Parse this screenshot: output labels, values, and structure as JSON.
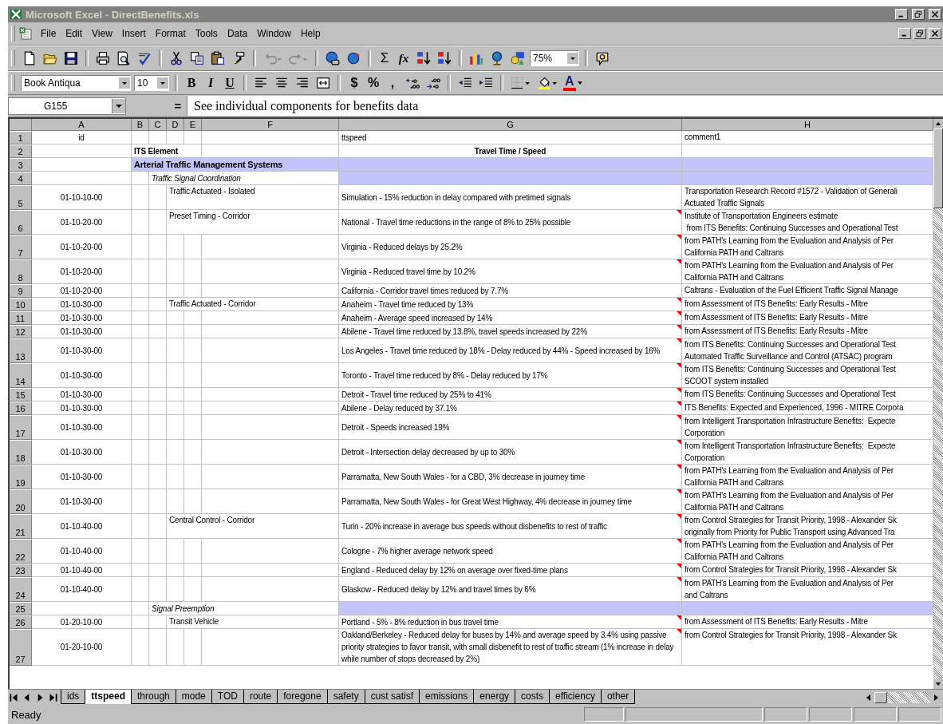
{
  "window": {
    "title": "Microsoft Excel - DirectBenefits.xls"
  },
  "menu": [
    "File",
    "Edit",
    "View",
    "Insert",
    "Format",
    "Tools",
    "Data",
    "Window",
    "Help"
  ],
  "standard_toolbar": {
    "undo": {
      "disabled": true
    },
    "redo": {
      "disabled": true
    },
    "autosum": "Σ",
    "function": "fx",
    "zoom": "75%"
  },
  "formatting_toolbar": {
    "font": "Book Antiqua",
    "size": "10",
    "bold": "B",
    "italic": "I",
    "underline": "U",
    "currency": "$",
    "percent": "%",
    "comma": ",",
    "font_color": "A"
  },
  "formula_bar": {
    "name_box": "G155",
    "equals": "=",
    "content": "See individual components for benefits data"
  },
  "columns": [
    "A",
    "B",
    "C",
    "D",
    "E",
    "F",
    "G",
    "H"
  ],
  "rows": [
    {
      "number": "1",
      "kind": "fields",
      "id": "id",
      "ttspeed": "ttspeed",
      "comment": "comment1",
      "note": false
    },
    {
      "number": "2",
      "kind": "heading",
      "label": "ITS Element",
      "ttspeed": "Travel Time / Speed",
      "note": false
    },
    {
      "number": "3",
      "kind": "group",
      "label": "Arterial Traffic Management Systems",
      "highlighted": true,
      "note": false
    },
    {
      "number": "4",
      "kind": "category",
      "label": "Traffic Signal Coordination",
      "highlighted": true,
      "note": false
    },
    {
      "number": "5",
      "kind": "entry",
      "id": "01-10-10-00",
      "label": "Traffic Actuated - Isolated",
      "ttspeed": "Simulation - 15% reduction in delay compared with pretimed signals",
      "comment": "Transportation Research Record #1572 - Validation of Generali\nActuated Traffic Signals",
      "note": false
    },
    {
      "number": "6",
      "kind": "entry",
      "id": "01-10-20-00",
      "label": "Preset Timing - Corridor",
      "ttspeed": "National - Travel time reductions in the range of 8% to 25% possible",
      "comment": "Institute of Transportation Engineers estimate\n from ITS Benefits: Continuing Successes and Operational Test",
      "note": true
    },
    {
      "number": "7",
      "kind": "entry",
      "id": "01-10-20-00",
      "ttspeed": "Virginia - Reduced delays by 25.2%",
      "comment": "from PATH's Learning from the Evaluation and Analysis of Per\nCalifornia PATH and Caltrans",
      "note": true
    },
    {
      "number": "8",
      "kind": "entry",
      "id": "01-10-20-00",
      "ttspeed": "Virginia - Reduced travel time by 10.2%",
      "comment": "from PATH's Learning from the Evaluation and Analysis of Per\nCalifornia PATH and Caltrans",
      "note": true
    },
    {
      "number": "9",
      "kind": "entry",
      "id": "01-10-20-00",
      "ttspeed": "California - Corridor travel times reduced by 7.7%",
      "comment": "Caltrans - Evaluation of the Fuel Efficient Traffic Signal Manage",
      "note": false
    },
    {
      "number": "10",
      "kind": "entry",
      "id": "01-10-30-00",
      "label": "Traffic Actuated - Corridor",
      "ttspeed": "Anaheim - Travel time reduced by 13%",
      "comment": "from Assessment of ITS Benefits: Early Results - Mitre",
      "note": true
    },
    {
      "number": "11",
      "kind": "entry",
      "id": "01-10-30-00",
      "ttspeed": "Anaheim - Average speed increased by 14%",
      "comment": "from Assessment of ITS Benefits: Early Results - Mitre",
      "note": true
    },
    {
      "number": "12",
      "kind": "entry",
      "id": "01-10-30-00",
      "ttspeed": "Abilene - Travel time reduced by 13.8%, travel speeds increased by 22%",
      "comment": "from Assessment of ITS Benefits: Early Results - Mitre",
      "note": true
    },
    {
      "number": "13",
      "kind": "entry",
      "id": "01-10-30-00",
      "ttspeed": "Los Angeles - Travel time reduced by 18% - Delay reduced by 44% - Speed increased by 16%",
      "comment": "from ITS Benefits: Continuing Successes and Operational Test\nAutomated Traffic Surveillance and Control (ATSAC) program",
      "note": true
    },
    {
      "number": "14",
      "kind": "entry",
      "id": "01-10-30-00",
      "ttspeed": "Toronto - Travel time reduced by 8% - Delay reduced by 17%",
      "comment": "from ITS Benefits: Continuing Successes and Operational Test\nSCOOT system installed",
      "note": true
    },
    {
      "number": "15",
      "kind": "entry",
      "id": "01-10-30-00",
      "ttspeed": "Detroit - Travel time reduced by 25% to 41%",
      "comment": "from ITS Benefits: Continuing Successes and Operational Test",
      "note": true
    },
    {
      "number": "16",
      "kind": "entry",
      "id": "01-10-30-00",
      "ttspeed": "Abilene - Delay reduced by 37.1%",
      "comment": "ITS Benefits: Expected and Experienced, 1996 - MITRE Corpora",
      "note": true
    },
    {
      "number": "17",
      "kind": "entry",
      "id": "01-10-30-00",
      "ttspeed": "Detroit - Speeds increased 19%",
      "comment": "from Intelligent Transportation Infrastructure Benefits:  Expecte\nCorporation",
      "note": true
    },
    {
      "number": "18",
      "kind": "entry",
      "id": "01-10-30-00",
      "ttspeed": "Detroit - Intersection delay decreased by up to 30%",
      "comment": "from Intelligent Transportation Infrastructure Benefits:  Expecte\nCorporation",
      "note": true
    },
    {
      "number": "19",
      "kind": "entry",
      "id": "01-10-30-00",
      "ttspeed": "Parramatta, New South Wales - for a CBD, 3% decrease in journey time",
      "comment": "from PATH's Learning from the Evaluation and Analysis of Per\nCalifornia PATH and Caltrans",
      "note": true
    },
    {
      "number": "20",
      "kind": "entry",
      "id": "01-10-30-00",
      "ttspeed": "Parramatta, New South Wales - for Great West Highway, 4% decrease in journey time",
      "comment": "from PATH's Learning from the Evaluation and Analysis of Per\nCalifornia PATH and Caltrans",
      "note": true
    },
    {
      "number": "21",
      "kind": "entry",
      "id": "01-10-40-00",
      "label": "Central Control - Corridor",
      "ttspeed": "Turin - 20% increase in average bus speeds without disbenefits to rest of traffic",
      "comment": "from Control Strategies for Transit Priority, 1998 - Alexander Sk\noriginally from Priority for Public Transport using Advanced Tra",
      "note": true
    },
    {
      "number": "22",
      "kind": "entry",
      "id": "01-10-40-00",
      "ttspeed": "Cologne - 7% higher average network speed",
      "comment": "from PATH's Learning from the Evaluation and Analysis of Per\nCalifornia PATH and Caltrans",
      "note": true
    },
    {
      "number": "23",
      "kind": "entry",
      "id": "01-10-40-00",
      "ttspeed": "England - Reduced delay by 12% on average over fixed-time plans",
      "comment": "from Control Strategies for Transit Priority, 1998 - Alexander Sk",
      "note": true
    },
    {
      "number": "24",
      "kind": "entry",
      "id": "01-10-40-00",
      "ttspeed": "Glaskow - Reduced delay by 12% and travel times by 6%",
      "comment": "from PATH's Learning from the Evaluation and Analysis of Per\nand Caltrans",
      "note": true
    },
    {
      "number": "25",
      "kind": "category",
      "label": "Signal Preemption",
      "highlighted": true,
      "note": false
    },
    {
      "number": "26",
      "kind": "entry",
      "id": "01-20-10-00",
      "label": "Transit Vehicle",
      "ttspeed": "Portland - 5% - 8% reduction in bus travel time",
      "comment": "from Assessment of ITS Benefits: Early Results - Mitre",
      "note": true
    },
    {
      "number": "27",
      "kind": "entry",
      "id": "01-20-10-00",
      "ttspeed": "Oakland/Berkeley - Reduced delay for buses by 14% and average speed by 3.4% using passive priority strategies to favor transit, with small disbenefit to rest of traffic stream (1% increase in delay while number of stops decreased by 2%)",
      "comment": "from Control Strategies for Transit Priority, 1998 - Alexander Sk",
      "note": true
    }
  ],
  "sheet_tabs": [
    {
      "label": "ids",
      "selected": false
    },
    {
      "label": "ttspeed",
      "selected": true
    },
    {
      "label": "through",
      "selected": false
    },
    {
      "label": "mode",
      "selected": false
    },
    {
      "label": "TOD",
      "selected": false
    },
    {
      "label": "route",
      "selected": false
    },
    {
      "label": "foregone",
      "selected": false
    },
    {
      "label": "safety",
      "selected": false
    },
    {
      "label": "cust satisf",
      "selected": false
    },
    {
      "label": "emissions",
      "selected": false
    },
    {
      "label": "energy",
      "selected": false
    },
    {
      "label": "costs",
      "selected": false
    },
    {
      "label": "efficiency",
      "selected": false
    },
    {
      "label": "other",
      "selected": false
    }
  ],
  "status_bar": {
    "text": "Ready"
  }
}
